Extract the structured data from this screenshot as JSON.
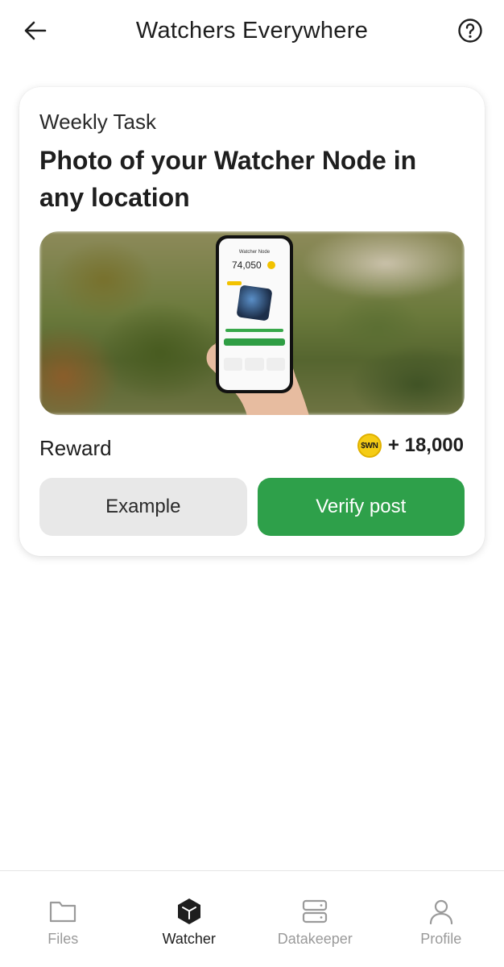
{
  "header": {
    "title": "Watchers Everywhere",
    "back_icon": "arrow-left-icon",
    "help_icon": "question-circle-icon"
  },
  "task_card": {
    "subtitle": "Weekly Task",
    "title": "Photo of your Watcher Node in any location",
    "image": {
      "description_icon": "hand-holding-phone-photo",
      "phone_screen": {
        "title": "Watcher Node",
        "balance": "74,050"
      }
    },
    "reward_label": "Reward",
    "reward_coin_label": "$WN",
    "reward_amount": "+ 18,000",
    "example_button": "Example",
    "verify_button": "Verify post"
  },
  "colors": {
    "accent_green": "#2ea04a",
    "coin_yellow": "#f5cc15",
    "secondary_button": "#e8e8e8"
  },
  "bottom_nav": {
    "items": [
      {
        "label": "Files",
        "icon": "folder-icon",
        "active": false
      },
      {
        "label": "Watcher",
        "icon": "cube-icon",
        "active": true
      },
      {
        "label": "Datakeeper",
        "icon": "server-icon",
        "active": false
      },
      {
        "label": "Profile",
        "icon": "user-icon",
        "active": false
      }
    ]
  }
}
